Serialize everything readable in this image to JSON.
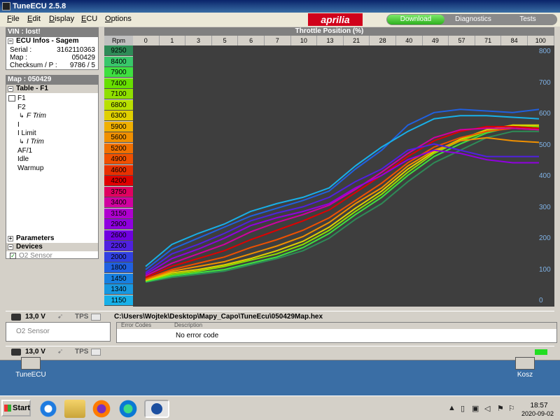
{
  "window": {
    "title": "TuneECU 2.5.8"
  },
  "menu": [
    "File",
    "Edit",
    "Display",
    "ECU",
    "Options"
  ],
  "brand": "aprilia",
  "nav_tabs": [
    "Download",
    "Diagnostics",
    "Tests"
  ],
  "vin_panel": {
    "title": "VIN : lost!"
  },
  "ecu_infos": {
    "title": "ECU Infos -  Sagem",
    "rows": [
      {
        "label": "Serial :",
        "value": "3162110363"
      },
      {
        "label": "Map :",
        "value": "050429"
      },
      {
        "label": "Checksum / P :",
        "value": "9786 / 5"
      }
    ]
  },
  "map_panel": {
    "title": "Map : 050429",
    "table_header": "Table - F1"
  },
  "tree": [
    {
      "label": "F1",
      "italic": false
    },
    {
      "label": "F2",
      "italic": false
    },
    {
      "label": "F Trim",
      "italic": true
    },
    {
      "label": "I",
      "italic": false
    },
    {
      "label": "I Limit",
      "italic": false
    },
    {
      "label": "I Trim",
      "italic": true
    },
    {
      "label": "AF/1",
      "italic": false
    },
    {
      "label": "Idle",
      "italic": false
    },
    {
      "label": "Warmup",
      "italic": false
    }
  ],
  "sections": {
    "parameters": "Parameters",
    "devices": "Devices",
    "o2_sensor": "O2 Sensor"
  },
  "grid": {
    "title": "Throttle Position (%)",
    "rpm_label": "Rpm",
    "throttle_cols": [
      "0",
      "1",
      "3",
      "5",
      "6",
      "7",
      "10",
      "13",
      "21",
      "28",
      "40",
      "49",
      "57",
      "71",
      "84",
      "100"
    ],
    "rpm_rows": [
      "9250",
      "8400",
      "7900",
      "7400",
      "7100",
      "6800",
      "6300",
      "5900",
      "5600",
      "5200",
      "4900",
      "4600",
      "4200",
      "3750",
      "3400",
      "3150",
      "2900",
      "2600",
      "2200",
      "2000",
      "1800",
      "1450",
      "1340",
      "1150"
    ],
    "row_colors": [
      "#2e8b57",
      "#38c76a",
      "#3ee040",
      "#67e000",
      "#8fe000",
      "#b8e000",
      "#e0d000",
      "#f0b000",
      "#f09000",
      "#f07000",
      "#f05000",
      "#e83000",
      "#e00000",
      "#e00060",
      "#d000a0",
      "#b000d0",
      "#9000e0",
      "#7000e0",
      "#5020e0",
      "#3040e0",
      "#2060e0",
      "#1880e0",
      "#1898e0",
      "#18b0e8"
    ],
    "y_ticks": [
      "800",
      "700",
      "600",
      "500",
      "400",
      "300",
      "200",
      "100",
      "0"
    ]
  },
  "chart_data": {
    "type": "line",
    "x": [
      0,
      1,
      3,
      5,
      6,
      7,
      10,
      13,
      21,
      28,
      40,
      49,
      57,
      71,
      84,
      100
    ],
    "ylim": [
      0,
      800
    ],
    "series": [
      {
        "color": "#2e8b57",
        "values": [
          60,
          75,
          85,
          95,
          115,
          135,
          160,
          200,
          260,
          310,
          380,
          440,
          480,
          520,
          540,
          540
        ]
      },
      {
        "color": "#3ee040",
        "values": [
          62,
          80,
          90,
          100,
          120,
          140,
          170,
          215,
          275,
          330,
          400,
          460,
          500,
          535,
          555,
          550
        ]
      },
      {
        "color": "#8fe000",
        "values": [
          65,
          85,
          95,
          110,
          130,
          150,
          180,
          225,
          285,
          340,
          410,
          470,
          510,
          540,
          560,
          555
        ]
      },
      {
        "color": "#e0d000",
        "values": [
          65,
          90,
          100,
          115,
          135,
          160,
          190,
          235,
          295,
          350,
          420,
          475,
          515,
          545,
          560,
          560
        ]
      },
      {
        "color": "#f09000",
        "values": [
          68,
          95,
          110,
          125,
          150,
          175,
          205,
          250,
          310,
          360,
          430,
          480,
          510,
          520,
          510,
          505
        ]
      },
      {
        "color": "#f05000",
        "values": [
          70,
          100,
          120,
          140,
          170,
          195,
          225,
          265,
          320,
          375,
          440,
          490,
          520,
          540,
          550,
          545
        ]
      },
      {
        "color": "#e00000",
        "values": [
          75,
          110,
          135,
          160,
          195,
          225,
          255,
          290,
          345,
          400,
          460,
          510,
          540,
          555,
          555,
          550
        ]
      },
      {
        "color": "#d000a0",
        "values": [
          80,
          120,
          150,
          180,
          220,
          250,
          275,
          305,
          355,
          410,
          470,
          520,
          545,
          550,
          550,
          545
        ]
      },
      {
        "color": "#9000e0",
        "values": [
          85,
          135,
          165,
          200,
          240,
          265,
          285,
          310,
          360,
          400,
          450,
          480,
          470,
          450,
          440,
          440
        ]
      },
      {
        "color": "#5020e0",
        "values": [
          90,
          150,
          180,
          215,
          255,
          280,
          300,
          330,
          380,
          420,
          480,
          500,
          480,
          460,
          460,
          460
        ]
      },
      {
        "color": "#2060e0",
        "values": [
          100,
          165,
          200,
          235,
          270,
          295,
          320,
          350,
          420,
          480,
          560,
          600,
          610,
          605,
          600,
          610
        ]
      },
      {
        "color": "#18b0e8",
        "values": [
          110,
          180,
          215,
          245,
          285,
          310,
          330,
          360,
          430,
          490,
          540,
          580,
          590,
          590,
          585,
          580
        ]
      }
    ]
  },
  "status": {
    "voltage": "13,0 V",
    "tps": "TPS",
    "file_path": "C:\\Users\\Wojtek\\Desktop\\Mapy_Capo\\TuneEcu\\050429Map.hex"
  },
  "errors": {
    "header_code": "Error Codes",
    "header_desc": "Description",
    "message": "No error code"
  },
  "desktop": {
    "icon_left": "TuneECU",
    "icon_right": "Kosz"
  },
  "taskbar": {
    "start": "Start",
    "time": "18:57",
    "date": "2020-09-02"
  }
}
